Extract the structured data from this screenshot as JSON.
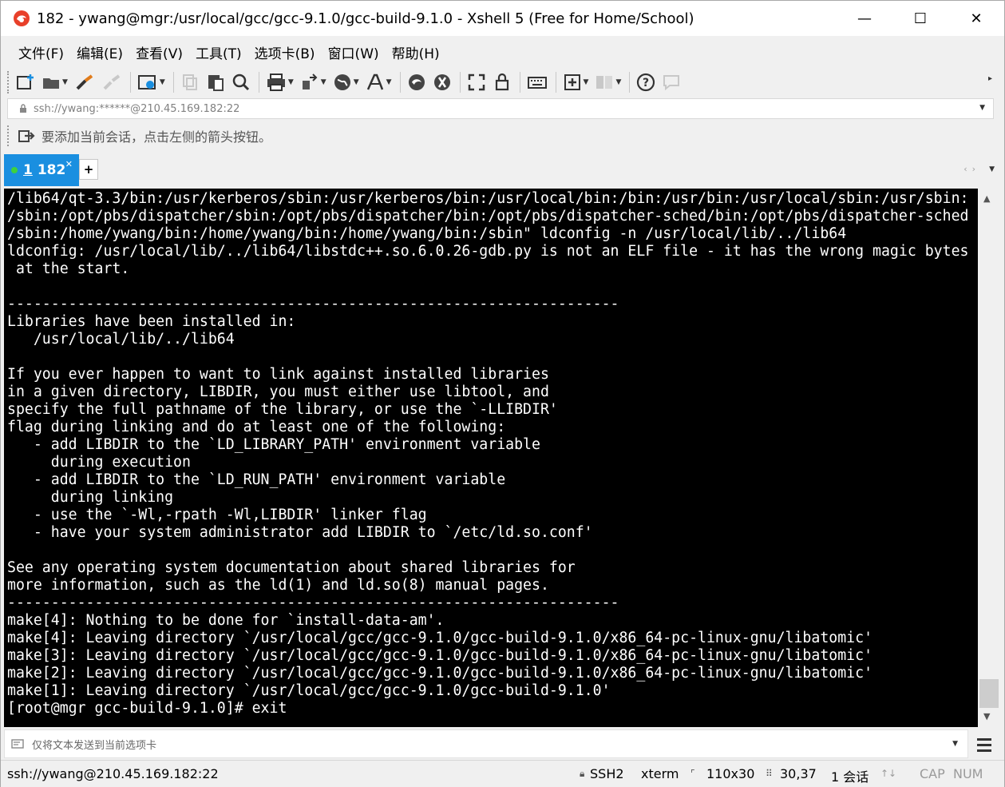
{
  "window": {
    "title": "182 - ywang@mgr:/usr/local/gcc/gcc-9.1.0/gcc-build-9.1.0 - Xshell 5 (Free for Home/School)",
    "controls": {
      "minimize": "—",
      "maximize": "☐",
      "close": "✕"
    }
  },
  "menu": [
    "文件(F)",
    "编辑(E)",
    "查看(V)",
    "工具(T)",
    "选项卡(B)",
    "窗口(W)",
    "帮助(H)"
  ],
  "toolbar": {
    "buttons": [
      "new-session-icon",
      "open-folder-icon",
      "reconnect-icon",
      "disconnect-icon",
      "properties-icon",
      "copy-icon",
      "paste-icon",
      "find-icon",
      "print-icon",
      "transfer-icon",
      "globe-icon",
      "font-icon",
      "xftp-icon",
      "xmanager-icon",
      "fullscreen-icon",
      "lock-icon",
      "keyboard-icon",
      "new-tab-icon",
      "layout-icon",
      "help-icon",
      "chat-icon"
    ]
  },
  "address": {
    "text": "ssh://ywang:******@210.45.169.182:22"
  },
  "hint": {
    "text": "要添加当前会话，点击左侧的箭头按钮。"
  },
  "tabs": {
    "active": {
      "number": "1",
      "label": "182"
    },
    "add": "+"
  },
  "terminal": {
    "lines": [
      "/lib64/qt-3.3/bin:/usr/kerberos/sbin:/usr/kerberos/bin:/usr/local/bin:/bin:/usr/bin:/usr/local/sbin:/usr/sbin:",
      "/sbin:/opt/pbs/dispatcher/sbin:/opt/pbs/dispatcher/bin:/opt/pbs/dispatcher-sched/bin:/opt/pbs/dispatcher-sched",
      "/sbin:/home/ywang/bin:/home/ywang/bin:/home/ywang/bin:/sbin\" ldconfig -n /usr/local/lib/../lib64",
      "ldconfig: /usr/local/lib/../lib64/libstdc++.so.6.0.26-gdb.py is not an ELF file - it has the wrong magic bytes",
      " at the start.",
      "",
      "----------------------------------------------------------------------",
      "Libraries have been installed in:",
      "   /usr/local/lib/../lib64",
      "",
      "If you ever happen to want to link against installed libraries",
      "in a given directory, LIBDIR, you must either use libtool, and",
      "specify the full pathname of the library, or use the `-LLIBDIR'",
      "flag during linking and do at least one of the following:",
      "   - add LIBDIR to the `LD_LIBRARY_PATH' environment variable",
      "     during execution",
      "   - add LIBDIR to the `LD_RUN_PATH' environment variable",
      "     during linking",
      "   - use the `-Wl,-rpath -Wl,LIBDIR' linker flag",
      "   - have your system administrator add LIBDIR to `/etc/ld.so.conf'",
      "",
      "See any operating system documentation about shared libraries for",
      "more information, such as the ld(1) and ld.so(8) manual pages.",
      "----------------------------------------------------------------------",
      "make[4]: Nothing to be done for `install-data-am'.",
      "make[4]: Leaving directory `/usr/local/gcc/gcc-9.1.0/gcc-build-9.1.0/x86_64-pc-linux-gnu/libatomic'",
      "make[3]: Leaving directory `/usr/local/gcc/gcc-9.1.0/gcc-build-9.1.0/x86_64-pc-linux-gnu/libatomic'",
      "make[2]: Leaving directory `/usr/local/gcc/gcc-9.1.0/gcc-build-9.1.0/x86_64-pc-linux-gnu/libatomic'",
      "make[1]: Leaving directory `/usr/local/gcc/gcc-9.1.0/gcc-build-9.1.0'",
      "[root@mgr gcc-build-9.1.0]# exit"
    ]
  },
  "compose": {
    "placeholder": "仅将文本发送到当前选项卡"
  },
  "status": {
    "connection": "ssh://ywang@210.45.169.182:22",
    "protocol": "SSH2",
    "terminal_type": "xterm",
    "size": "110x30",
    "cursor": "30,37",
    "sessions": "1 会话",
    "caps": "CAP",
    "num": "NUM"
  },
  "colors": {
    "tab_active": "#1a8fe0",
    "terminal_bg": "#000000",
    "terminal_fg": "#ffffff"
  }
}
